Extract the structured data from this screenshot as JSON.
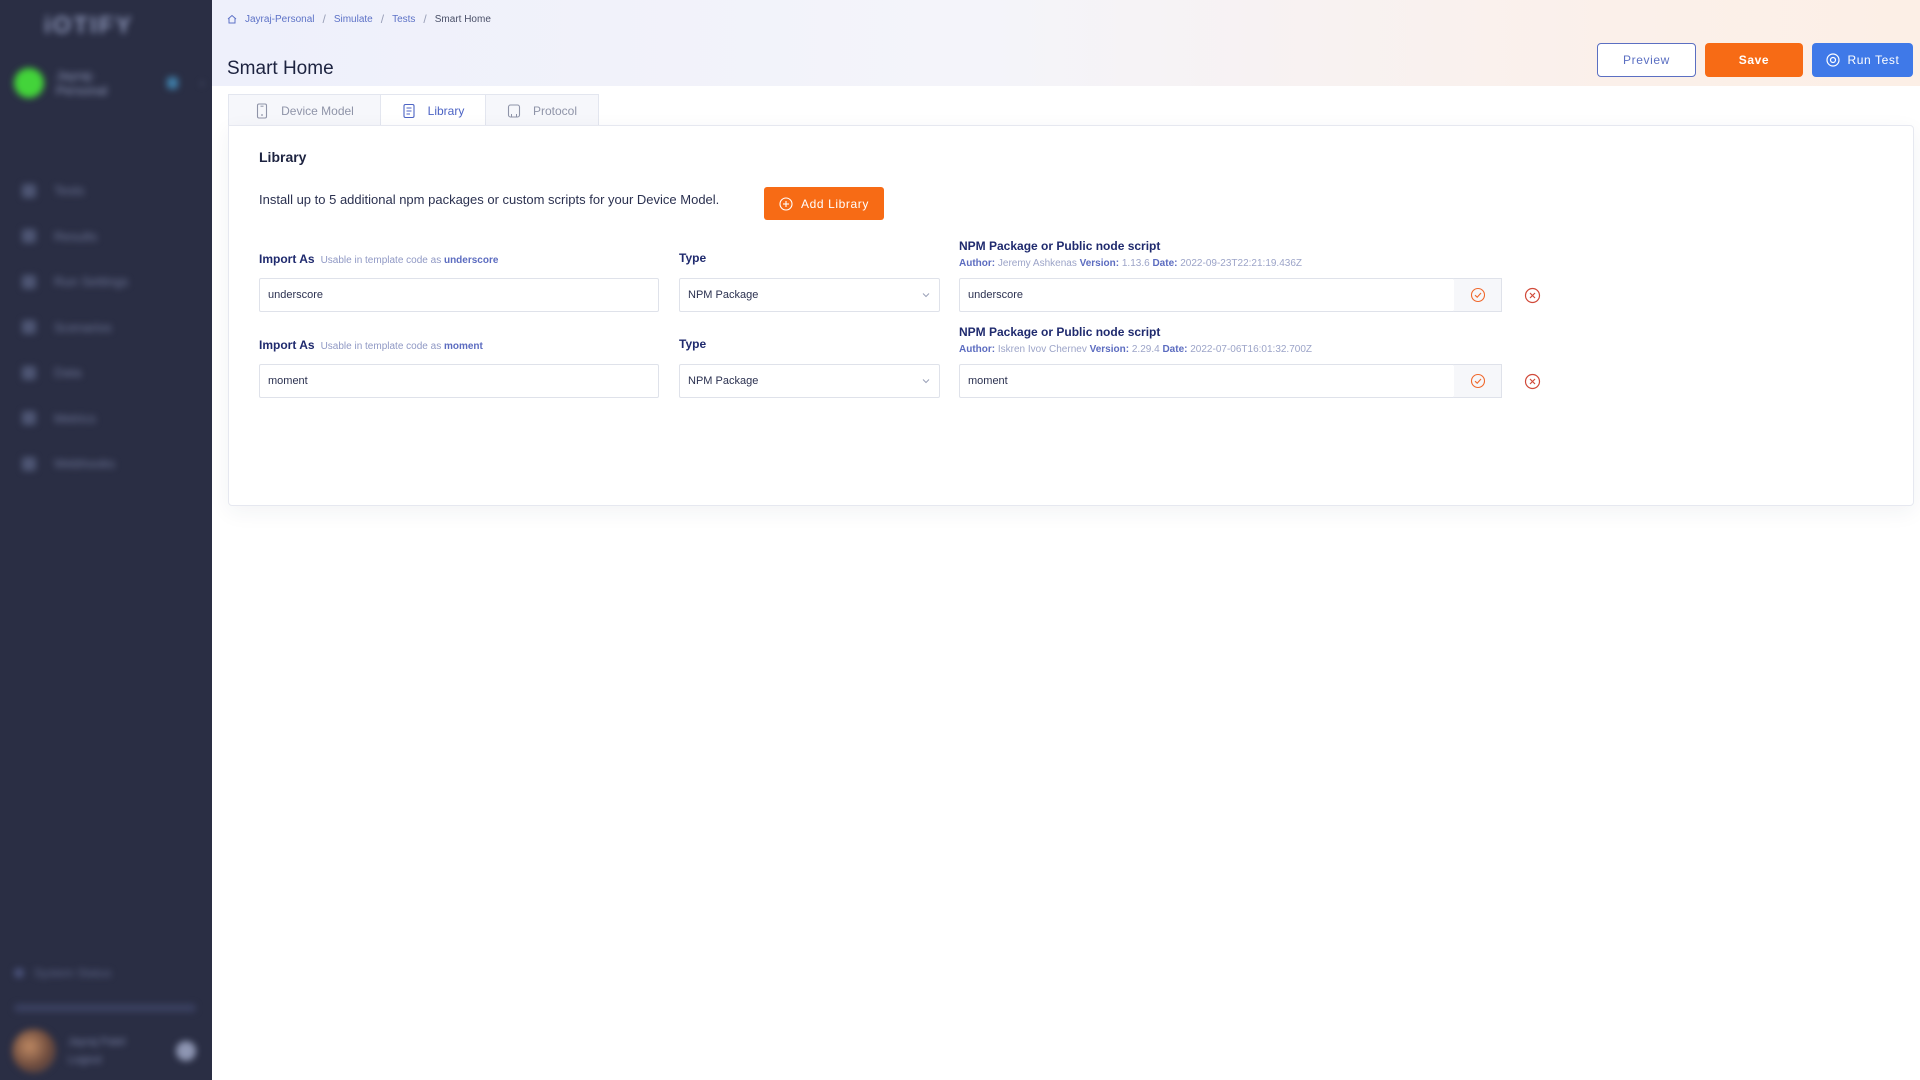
{
  "sidebar": {
    "logo": "iOTIFY",
    "workspace_name": "Jayraj-Personal",
    "nav": [
      {
        "label": "Tests",
        "icon": "tests-icon"
      },
      {
        "label": "Results",
        "icon": "results-icon"
      },
      {
        "label": "Run Settings",
        "icon": "run-settings-icon"
      },
      {
        "label": "Scenarios",
        "icon": "scenarios-icon"
      },
      {
        "label": "Data",
        "icon": "data-icon"
      },
      {
        "label": "Metrics",
        "icon": "metrics-icon"
      },
      {
        "label": "Webhooks",
        "icon": "webhooks-icon"
      }
    ],
    "system_status": "System Status",
    "user_name": "Jayraj Patel",
    "user_action": "Logout"
  },
  "breadcrumb": [
    "Jayraj-Personal",
    "Simulate",
    "Tests",
    "Smart Home"
  ],
  "page_title": "Smart Home",
  "actions": {
    "preview": "Preview",
    "save": "Save",
    "run": "Run Test"
  },
  "tabs": [
    {
      "label": "Device Model",
      "active": false
    },
    {
      "label": "Library",
      "active": true
    },
    {
      "label": "Protocol",
      "active": false
    }
  ],
  "library": {
    "title": "Library",
    "description": "Install up to 5 additional npm packages or custom scripts for your Device Model.",
    "add_button": "Add Library",
    "labels": {
      "import_as": "Import As",
      "usable_hint": "Usable in template code as",
      "type": "Type",
      "package": "NPM Package or Public node script",
      "author": "Author:",
      "version": "Version:",
      "date": "Date:"
    },
    "rows": [
      {
        "import_as": "underscore",
        "type": "NPM Package",
        "package": "underscore",
        "author": "Jeremy Ashkenas",
        "version": "1.13.6",
        "date": "2022-09-23T22:21:19.436Z"
      },
      {
        "import_as": "moment",
        "type": "NPM Package",
        "package": "moment",
        "author": "Iskren Ivov Chernev",
        "version": "2.29.4",
        "date": "2022-07-06T16:01:32.700Z"
      }
    ]
  },
  "colors": {
    "sidebar_bg": "#2a2e44",
    "primary": "#3f79e8",
    "accent": "#f76b15",
    "label": "#1f2a6e",
    "success": "#f0682c",
    "danger": "#d14a3a"
  }
}
